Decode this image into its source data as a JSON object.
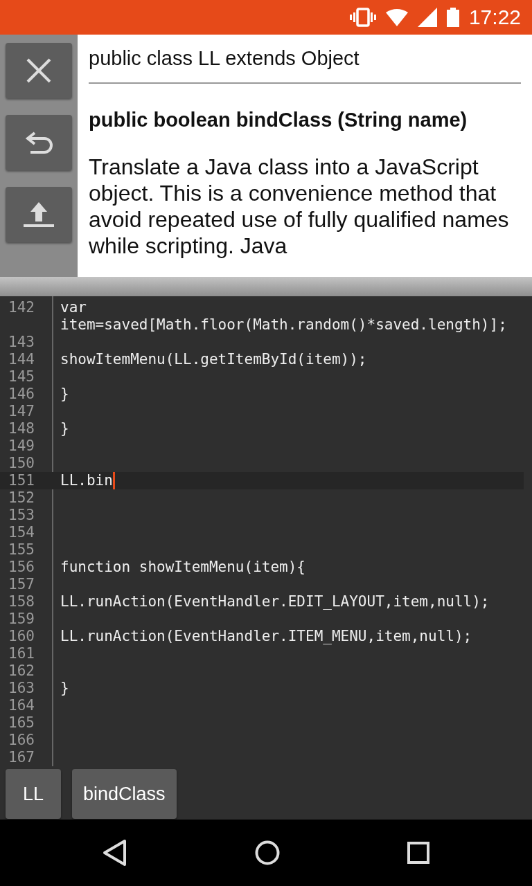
{
  "status_bar": {
    "time": "17:22"
  },
  "sidebar": {
    "buttons": [
      {
        "kind": "close"
      },
      {
        "kind": "undo"
      },
      {
        "kind": "upload"
      }
    ]
  },
  "doc": {
    "class_signature": "public class LL extends Object",
    "method_signature": "public boolean bindClass (String name)",
    "description": "Translate a Java class into a JavaScript object. This is a convenience method that avoid repeated use of fully qualified names while scripting. Java"
  },
  "editor": {
    "lines": [
      {
        "number": "142",
        "text": "var item=saved[Math.floor(Math.random()*saved.length)];",
        "current": false
      },
      {
        "number": "143",
        "current": false
      },
      {
        "number": "144",
        "text": "showItemMenu(LL.getItemById(item));",
        "current": false
      },
      {
        "number": "145",
        "current": false
      },
      {
        "number": "146",
        "text": "}",
        "current": false
      },
      {
        "number": "147",
        "current": false
      },
      {
        "number": "148",
        "text": "}",
        "current": false
      },
      {
        "number": "149",
        "current": false
      },
      {
        "number": "150",
        "current": false
      },
      {
        "number": "151",
        "text": "LL.bin",
        "current": true
      },
      {
        "number": "152",
        "current": false
      },
      {
        "number": "153",
        "current": false
      },
      {
        "number": "154",
        "current": false
      },
      {
        "number": "155",
        "current": false
      },
      {
        "number": "156",
        "text": "function showItemMenu(item){",
        "current": false
      },
      {
        "number": "157",
        "current": false
      },
      {
        "number": "158",
        "text": "LL.runAction(EventHandler.EDIT_LAYOUT,item,null);",
        "current": false
      },
      {
        "number": "159",
        "current": false
      },
      {
        "number": "160",
        "text": "LL.runAction(EventHandler.ITEM_MENU,item,null);",
        "current": false
      },
      {
        "number": "161",
        "current": false
      },
      {
        "number": "162",
        "current": false
      },
      {
        "number": "163",
        "text": "}",
        "current": false
      },
      {
        "number": "164",
        "current": false
      },
      {
        "number": "165",
        "current": false
      },
      {
        "number": "166",
        "current": false
      },
      {
        "number": "167",
        "current": false
      }
    ]
  },
  "suggestions": [
    "LL",
    "bindClass"
  ]
}
